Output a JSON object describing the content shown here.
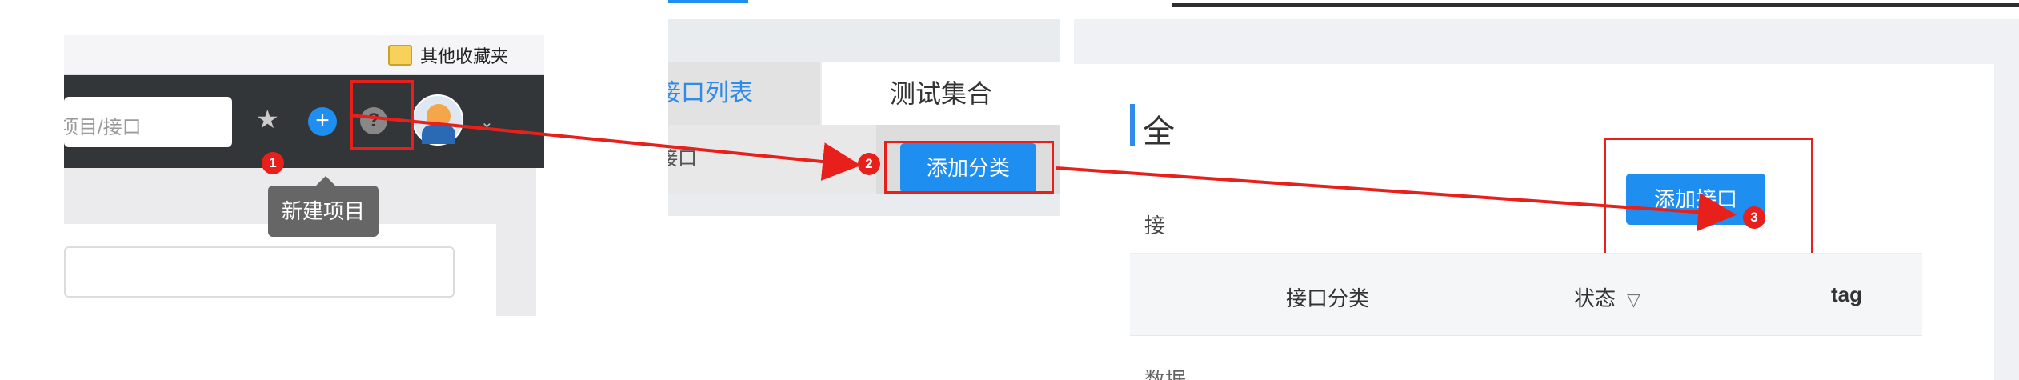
{
  "browser": {
    "bookmark_folder_label": "其他收藏夹",
    "search_placeholder": "项目/接口"
  },
  "toolbar": {
    "tooltip_text": "新建项目"
  },
  "interface_panel": {
    "tab_interface_list": "接口列表",
    "tab_test_collection": "测试集合",
    "row_label": "接口",
    "add_category_button": "添加分类"
  },
  "content_panel": {
    "title_fragment": "全",
    "side_label_fragment": "接",
    "add_interface_button": "添加接口",
    "table_headers": [
      "接口分类",
      "状态",
      "tag"
    ],
    "footer_fragment": "数据"
  },
  "steps": [
    "1",
    "2",
    "3"
  ],
  "colors": {
    "accent_blue": "#1e8ef0",
    "annotation_red": "#e8201c",
    "toolbar_dark": "#333639"
  },
  "icons": [
    "bookmark-folder-icon",
    "star-icon",
    "plus-circle-icon",
    "help-icon",
    "chevron-down-icon",
    "filter-icon"
  ]
}
